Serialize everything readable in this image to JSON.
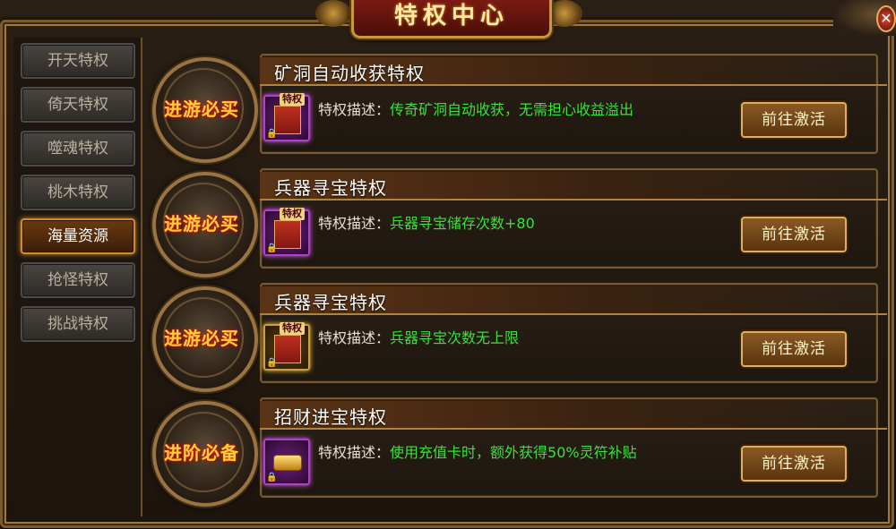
{
  "window": {
    "title": "特权中心",
    "close_icon": "close-icon"
  },
  "sidebar": {
    "items": [
      {
        "label": "开天特权",
        "active": false
      },
      {
        "label": "倚天特权",
        "active": false
      },
      {
        "label": "噬魂特权",
        "active": false
      },
      {
        "label": "桃木特权",
        "active": false
      },
      {
        "label": "海量资源",
        "active": true
      },
      {
        "label": "抢怪特权",
        "active": false
      },
      {
        "label": "挑战特权",
        "active": false
      }
    ]
  },
  "privileges": [
    {
      "badge": "进游必买",
      "title": "矿洞自动收获特权",
      "desc_label": "特权描述：",
      "desc_value": "传奇矿洞自动收获，无需担心收益溢出",
      "icon_tag": "特权",
      "icon": "privilege-scroll-icon",
      "button": "前往激活"
    },
    {
      "badge": "进游必买",
      "title": "兵器寻宝特权",
      "desc_label": "特权描述：",
      "desc_value": "兵器寻宝储存次数+80",
      "icon_tag": "特权",
      "icon": "privilege-scroll-icon",
      "button": "前往激活"
    },
    {
      "badge": "进游必买",
      "title": "兵器寻宝特权",
      "desc_label": "特权描述：",
      "desc_value": "兵器寻宝次数无上限",
      "icon_tag": "特权",
      "icon": "privilege-scroll-icon",
      "button": "前往激活"
    },
    {
      "badge": "进阶必备",
      "title": "招财进宝特权",
      "desc_label": "特权描述：",
      "desc_value": "使用充值卡时，额外获得50%灵符补贴",
      "icon_tag": "",
      "icon": "gold-ingot-card-icon",
      "button": "前往激活"
    }
  ],
  "colors": {
    "accent_gold": "#c8983e",
    "desc_value_green": "#3ae03a",
    "active_tab_border": "#d48a2a"
  }
}
